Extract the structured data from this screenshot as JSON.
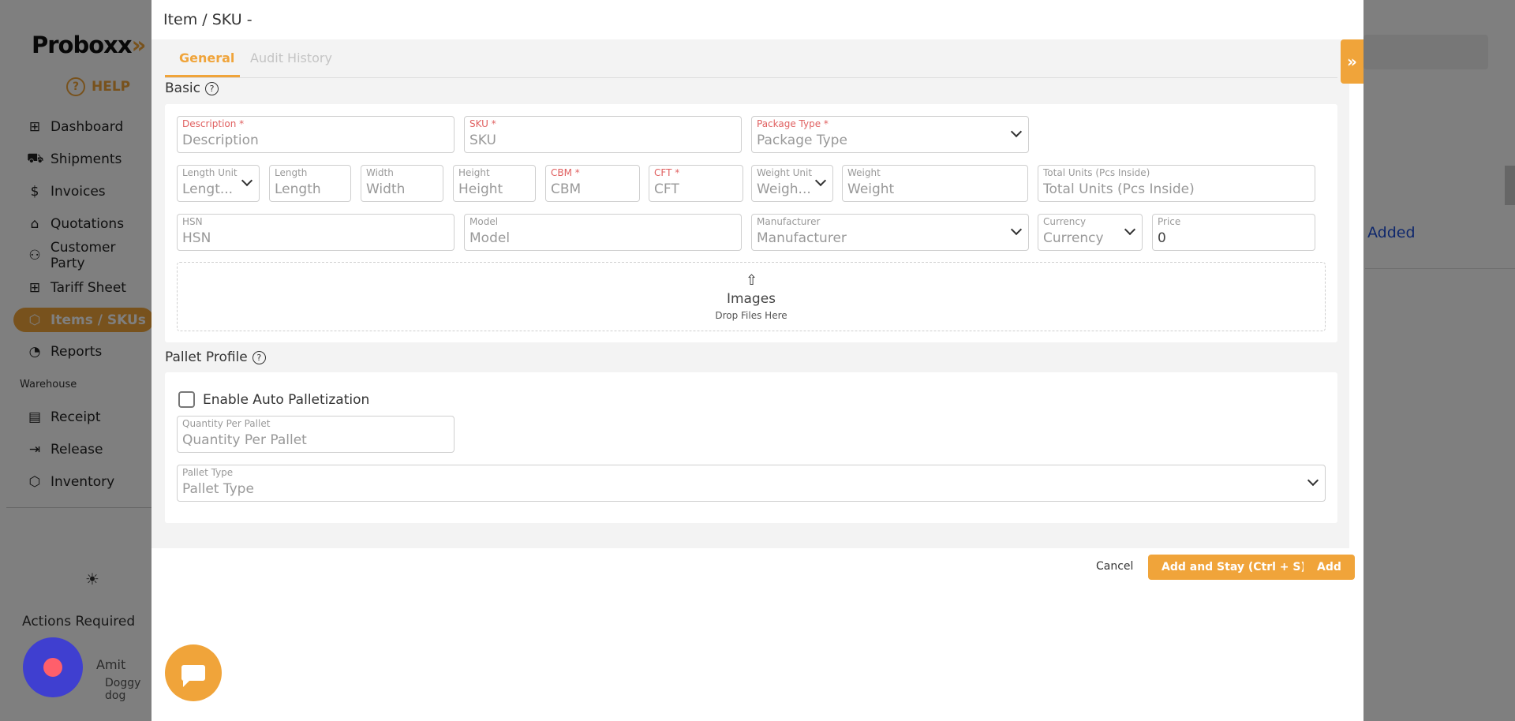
{
  "sidebar": {
    "logo": "Proboxx",
    "logo_arrows": "»",
    "help_label": "HELP",
    "items": [
      {
        "icon": "⊞",
        "label": "Dashboard"
      },
      {
        "icon": "⛟",
        "label": "Shipments"
      },
      {
        "icon": "$",
        "label": "Invoices"
      },
      {
        "icon": "⌂",
        "label": "Quotations"
      },
      {
        "icon": "⚇",
        "label": "Customer Party"
      },
      {
        "icon": "⊞",
        "label": "Tariff Sheet"
      },
      {
        "icon": "⬡",
        "label": "Items / SKUs"
      },
      {
        "icon": "◔",
        "label": "Reports"
      }
    ],
    "section_label": "Warehouse",
    "warehouse_items": [
      {
        "icon": "▤",
        "label": "Receipt"
      },
      {
        "icon": "⇥",
        "label": "Release"
      },
      {
        "icon": "⬡",
        "label": "Inventory"
      }
    ],
    "actions_label": "Actions Required",
    "user_name": "Amit",
    "user_sub": "Doggy dog",
    "accent": "#f0a43a"
  },
  "background": {
    "added_text": "Added"
  },
  "modal": {
    "title": "Item / SKU -",
    "tabs": [
      {
        "label": "General"
      },
      {
        "label": "Audit History"
      }
    ],
    "basic_title": "Basic",
    "fields": {
      "description": {
        "label": "Description *",
        "placeholder": "Description"
      },
      "sku": {
        "label": "SKU *",
        "placeholder": "SKU"
      },
      "package_type": {
        "label": "Package Type *",
        "placeholder": "Package Type"
      },
      "length_unit": {
        "label": "Length Unit",
        "placeholder": "Lengt..."
      },
      "length": {
        "label": "Length",
        "placeholder": "Length"
      },
      "width": {
        "label": "Width",
        "placeholder": "Width"
      },
      "height": {
        "label": "Height",
        "placeholder": "Height"
      },
      "cbm": {
        "label": "CBM *",
        "placeholder": "CBM"
      },
      "cft": {
        "label": "CFT *",
        "placeholder": "CFT"
      },
      "weight_unit": {
        "label": "Weight Unit",
        "placeholder": "Weigh..."
      },
      "weight": {
        "label": "Weight",
        "placeholder": "Weight"
      },
      "total_units": {
        "label": "Total Units (Pcs Inside)",
        "placeholder": "Total Units (Pcs Inside)"
      },
      "hsn": {
        "label": "HSN",
        "placeholder": "HSN"
      },
      "model": {
        "label": "Model",
        "placeholder": "Model"
      },
      "manufacturer": {
        "label": "Manufacturer",
        "placeholder": "Manufacturer"
      },
      "currency": {
        "label": "Currency",
        "placeholder": "Currency"
      },
      "price": {
        "label": "Price",
        "value": "0"
      }
    },
    "dropzone": {
      "title": "Images",
      "subtitle": "Drop Files Here"
    },
    "pallet_title": "Pallet Profile",
    "auto_palletization_label": "Enable Auto Palletization",
    "auto_palletization_checked": false,
    "qty_per_pallet": {
      "label": "Quantity Per Pallet",
      "placeholder": "Quantity Per Pallet"
    },
    "pallet_type": {
      "label": "Pallet Type",
      "placeholder": "Pallet Type"
    },
    "buttons": {
      "cancel": "Cancel",
      "add_and_stay": "Add and Stay (Ctrl + S)",
      "add": "Add"
    },
    "drawer_toggle": "»"
  }
}
